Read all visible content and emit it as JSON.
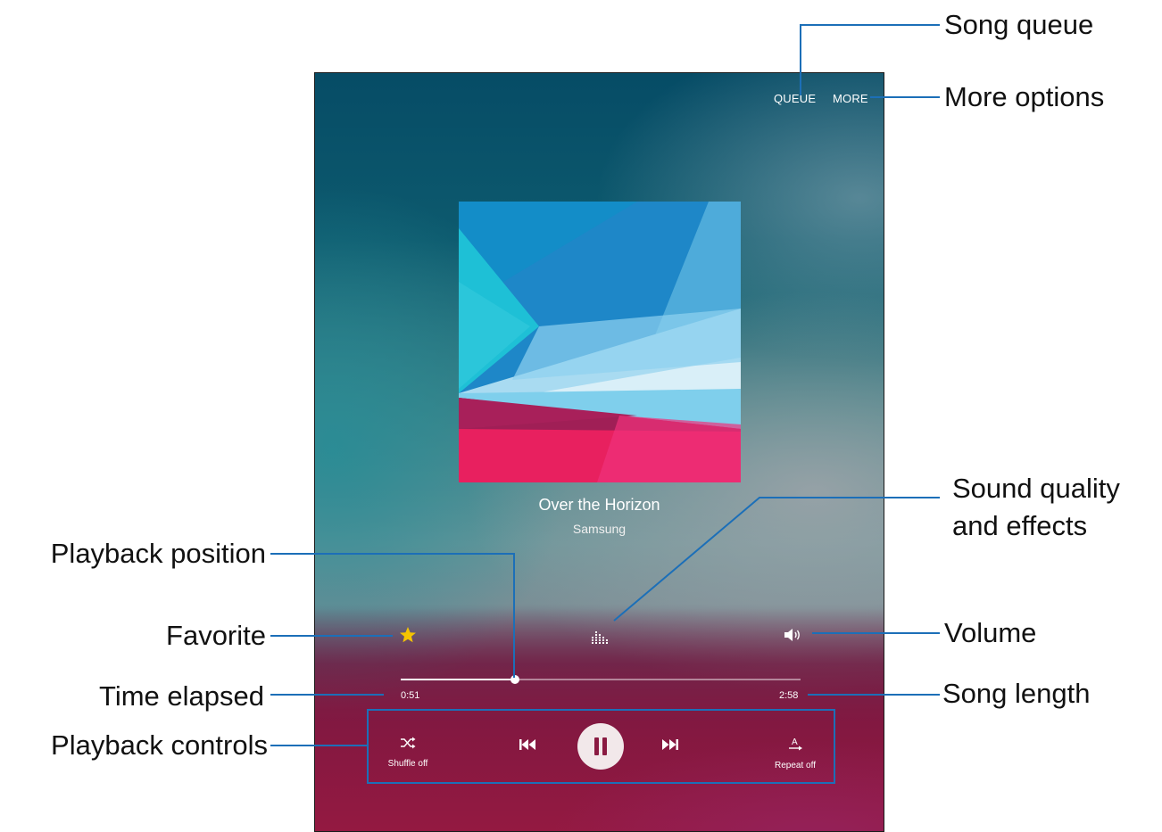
{
  "screen": {
    "queue_label": "QUEUE",
    "more_label": "MORE",
    "song_title": "Over the Horizon",
    "artist": "Samsung",
    "time_elapsed": "0:51",
    "song_length": "2:58",
    "progress_fraction": 0.286,
    "controls": {
      "shuffle_label": "Shuffle off",
      "repeat_label": "Repeat off"
    },
    "icons": {
      "favorite": "star-icon",
      "sound_quality": "equalizer-icon",
      "volume": "speaker-icon",
      "shuffle": "shuffle-icon",
      "previous": "previous-track-icon",
      "pause": "pause-icon",
      "next": "next-track-icon",
      "repeat": "repeat-icon"
    },
    "colors": {
      "favorite_star": "#f5c400",
      "callout_line": "#1c6fb8",
      "pause_button": "#f2e8ea",
      "pause_glyph": "#8a1a42"
    }
  },
  "callouts": {
    "song_queue": "Song queue",
    "more_options": "More options",
    "sound_quality_1": "Sound quality",
    "sound_quality_2": "and effects",
    "playback_position": "Playback position",
    "favorite": "Favorite",
    "volume": "Volume",
    "time_elapsed": "Time elapsed",
    "song_length": "Song length",
    "playback_controls": "Playback controls"
  }
}
